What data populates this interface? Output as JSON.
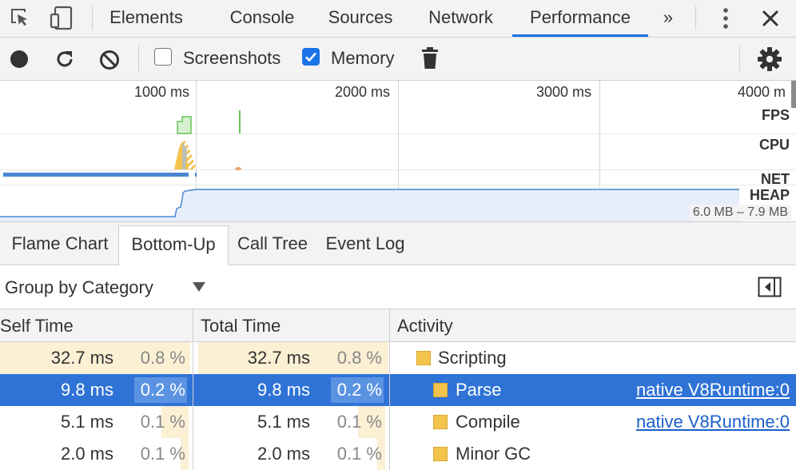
{
  "main_tabs": [
    {
      "label": "Elements"
    },
    {
      "label": "Console"
    },
    {
      "label": "Sources"
    },
    {
      "label": "Network"
    },
    {
      "label": "Performance",
      "active": true
    }
  ],
  "more_tabs_label": "»",
  "toolbar": {
    "screenshots_label": "Screenshots",
    "screenshots_checked": false,
    "memory_label": "Memory",
    "memory_checked": true
  },
  "overview": {
    "ticks": [
      "1000 ms",
      "2000 ms",
      "3000 ms",
      "4000 m"
    ],
    "lanes": {
      "fps": "FPS",
      "cpu": "CPU",
      "net": "NET",
      "heap": "HEAP"
    },
    "heap_range": "6.0 MB – 7.9 MB"
  },
  "sub_tabs": [
    {
      "label": "Flame Chart"
    },
    {
      "label": "Bottom-Up",
      "active": true
    },
    {
      "label": "Call Tree"
    },
    {
      "label": "Event Log"
    }
  ],
  "grouping": {
    "selected": "Group by Category"
  },
  "table": {
    "headers": {
      "self_time": "Self Time",
      "total_time": "Total Time",
      "activity": "Activity"
    },
    "rows": [
      {
        "self": "32.7 ms",
        "self_pct": "0.8 %",
        "total": "32.7 ms",
        "total_pct": "0.8 %",
        "activity": "Scripting",
        "expanded": true,
        "source": "",
        "fraction": 0.8
      },
      {
        "self": "9.8 ms",
        "self_pct": "0.2 %",
        "total": "9.8 ms",
        "total_pct": "0.2 %",
        "activity": "Parse",
        "expanded": false,
        "source": "native V8Runtime:0",
        "selected": true,
        "fraction": 0.2
      },
      {
        "self": "5.1 ms",
        "self_pct": "0.1 %",
        "total": "5.1 ms",
        "total_pct": "0.1 %",
        "activity": "Compile",
        "expanded": false,
        "source": "native V8Runtime:0",
        "fraction": 0.1
      },
      {
        "self": "2.0 ms",
        "self_pct": "0.1 %",
        "total": "2.0 ms",
        "total_pct": "0.1 %",
        "activity": "Minor GC",
        "expanded": false,
        "source": "",
        "fraction": 0.1
      }
    ]
  },
  "colors": {
    "accent": "#1a73e8",
    "selection": "#2f73d6",
    "scripting": "#f4c34b",
    "bar_tint": "#fbefd4",
    "link": "#1a5fc9"
  }
}
